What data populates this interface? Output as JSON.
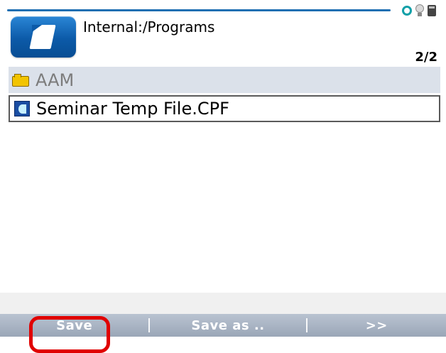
{
  "header": {
    "path": "Internal:/Programs",
    "counter": "2/2"
  },
  "list": {
    "items": [
      {
        "label": "AAM",
        "type": "folder"
      },
      {
        "label": "Seminar Temp File.CPF",
        "type": "file"
      }
    ]
  },
  "softkeys": {
    "save": "Save",
    "save_as": "Save as ..",
    "more": ">>"
  },
  "colors": {
    "header_line": "#1f6fb2",
    "folder_row": "#dbe1ea",
    "focus": "#e00000"
  },
  "icons": {
    "app": "folder-app-icon",
    "folder": "folder-icon",
    "file": "cpf-file-icon"
  }
}
